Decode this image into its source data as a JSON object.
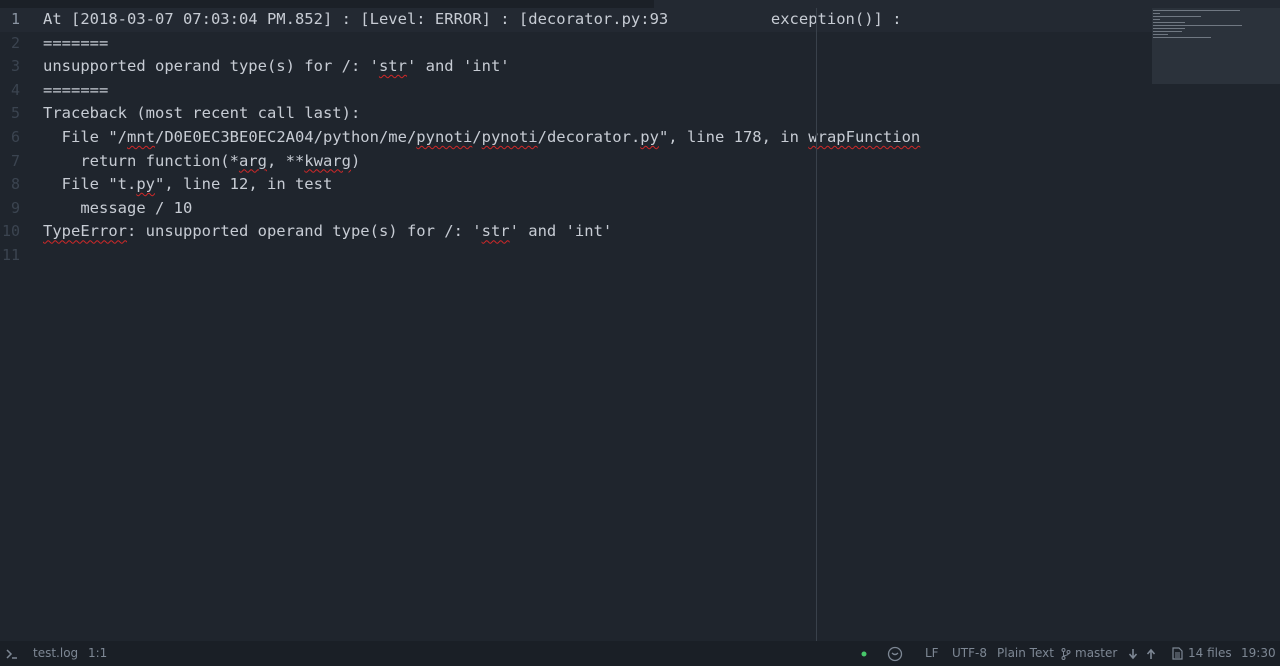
{
  "editor": {
    "current_line": 1,
    "line_numbers": [
      "1",
      "2",
      "3",
      "4",
      "5",
      "6",
      "7",
      "8",
      "9",
      "10",
      "11"
    ],
    "lines": [
      {
        "parts": [
          {
            "t": "At [2018-03-07 07:03:04 PM.852] : [Level: ERROR] : [decorator.py:93           exception()] :"
          }
        ]
      },
      {
        "parts": [
          {
            "t": "======="
          }
        ]
      },
      {
        "parts": [
          {
            "t": "unsupported operand type(s) for /: '"
          },
          {
            "t": "str",
            "sq": true
          },
          {
            "t": "' and 'int'"
          }
        ]
      },
      {
        "parts": [
          {
            "t": "======="
          }
        ]
      },
      {
        "parts": [
          {
            "t": "Traceback (most recent call last):"
          }
        ]
      },
      {
        "parts": [
          {
            "t": "  File \"/"
          },
          {
            "t": "mnt",
            "sq": true
          },
          {
            "t": "/D0E0EC3BE0EC2A04/python/me/"
          },
          {
            "t": "pynoti",
            "sq": true
          },
          {
            "t": "/"
          },
          {
            "t": "pynoti",
            "sq": true
          },
          {
            "t": "/decorator."
          },
          {
            "t": "py",
            "sq": true
          },
          {
            "t": "\", line 178, in "
          },
          {
            "t": "wrapFunction",
            "sq": true
          }
        ]
      },
      {
        "parts": [
          {
            "t": "    return function(*"
          },
          {
            "t": "arg",
            "sq": true
          },
          {
            "t": ", **"
          },
          {
            "t": "kwarg",
            "sq": true
          },
          {
            "t": ")"
          }
        ]
      },
      {
        "parts": [
          {
            "t": "  File \"t."
          },
          {
            "t": "py",
            "sq": true
          },
          {
            "t": "\", line 12, in test"
          }
        ]
      },
      {
        "parts": [
          {
            "t": "    message / 10"
          }
        ]
      },
      {
        "parts": [
          {
            "t": "TypeError",
            "sq": true
          },
          {
            "t": ": unsupported operand type(s) for /: '"
          },
          {
            "t": "str",
            "sq": true
          },
          {
            "t": "' and 'int'"
          }
        ]
      },
      {
        "parts": [
          {
            "t": ""
          }
        ]
      }
    ]
  },
  "status": {
    "file_name": "test.log",
    "cursor_position": "1:1",
    "line_ending": "LF",
    "encoding": "UTF-8",
    "grammar": "Plain Text",
    "branch": "master",
    "files_count": "14 files",
    "clock": "19:30",
    "icons": {
      "terminal": "terminal-icon",
      "git_status": "dot-icon",
      "github": "github-icon",
      "branch": "branch-icon",
      "fetch": "arrow-down-icon",
      "push": "arrow-up-icon",
      "files": "file-icon"
    },
    "accent": "#47c76a"
  }
}
